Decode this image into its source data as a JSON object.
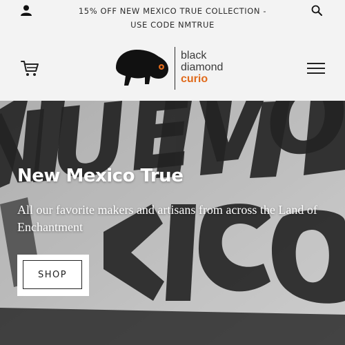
{
  "announcement": {
    "line1": "15% OFF NEW MEXICO TRUE COLLECTION -",
    "line2": "USE CODE NMTRUE"
  },
  "header": {
    "icons": {
      "account": "user-icon",
      "search": "search-icon",
      "cart": "cart-icon",
      "menu": "hamburger-menu-icon"
    },
    "logo": {
      "line1": "black",
      "line2": "diamond",
      "line3": "curio",
      "accent_color": "#e06a1b"
    }
  },
  "hero": {
    "title": "New Mexico True",
    "subtitle": "All our favorite makers and artisans from across the Land of Enchantment",
    "cta_label": "SHOP",
    "background_lettering": "NUEVO MEXICO"
  }
}
